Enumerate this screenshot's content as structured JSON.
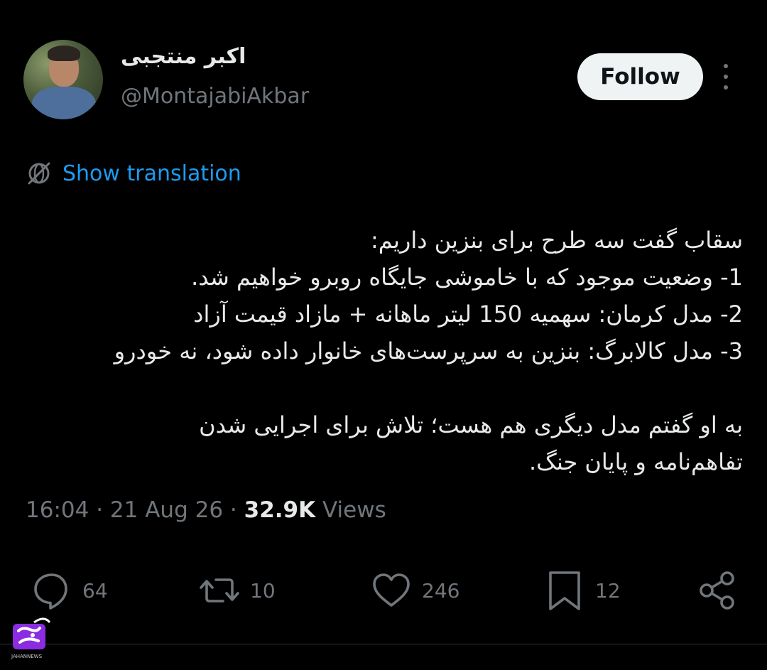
{
  "author": {
    "display_name": "اکبر منتجبی",
    "handle": "@MontajabiAkbar"
  },
  "follow_label": "Follow",
  "translation": {
    "label": "Show translation",
    "icon": "globe-slash-icon"
  },
  "tweet": {
    "lines": [
      "سقاب گفت سه طرح برای بنزین داریم:",
      "1- وضعیت موجود که با خاموشی جایگاه روبرو خواهیم شد.",
      "2- مدل کرمان: سهمیه 150 لیتر ماهانه + مازاد قیمت آزاد",
      "3- مدل کالابرگ: بنزین به سرپرست‌های خانوار داده شود، نه خودرو",
      "",
      "به او گفتم مدل دیگری هم هست؛ تلاش برای اجرایی شدن",
      "تفاهم‌نامه و پایان جنگ."
    ]
  },
  "meta": {
    "time": "16:04",
    "separator": "·",
    "date": "21 Aug 26",
    "views_count": "32.9K",
    "views_label": "Views"
  },
  "actions": {
    "replies": {
      "icon": "reply-icon",
      "count": "64"
    },
    "reposts": {
      "icon": "repost-icon",
      "count": "10"
    },
    "likes": {
      "icon": "heart-icon",
      "count": "246"
    },
    "bookmarks": {
      "icon": "bookmark-icon",
      "count": "12"
    },
    "share": {
      "icon": "share-icon"
    }
  },
  "watermark": {
    "text": "JAHANNEWS",
    "accent_color": "#8b2be2"
  },
  "colors": {
    "background": "#000000",
    "text": "#e7e9ea",
    "secondary": "#71767b",
    "link": "#1d9bf0"
  }
}
